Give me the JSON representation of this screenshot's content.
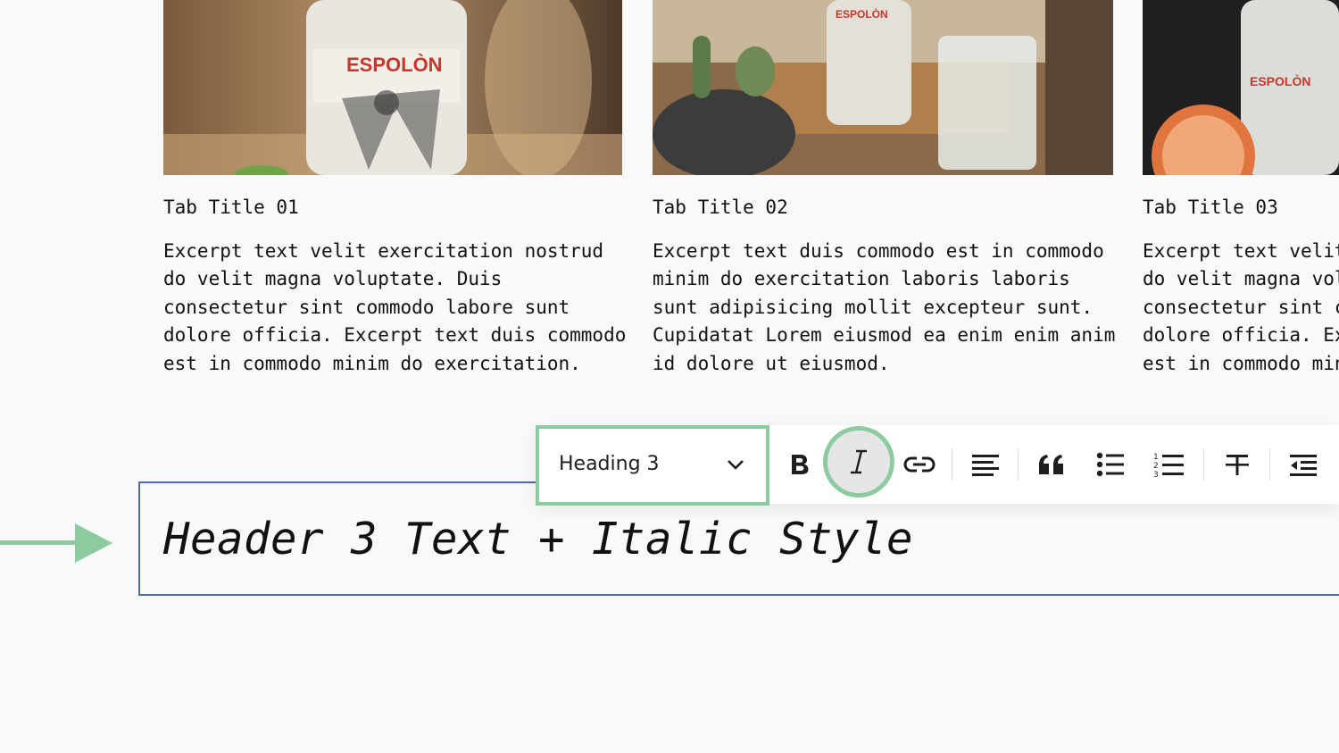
{
  "cards": [
    {
      "title": "Tab Title 01",
      "excerpt": "Excerpt text velit exercitation nostrud do velit magna voluptate. Duis consectetur sint commodo labore sunt dolore officia. Excerpt text duis commodo est in commodo minim do exercitation.",
      "image_alt": "Espolòn tequila bottle"
    },
    {
      "title": "Tab Title 02",
      "excerpt": "Excerpt text duis commodo est in commodo minim do exercitation laboris laboris sunt adipisicing mollit excepteur sunt. Cupidatat Lorem eiusmod ea enim enim anim id dolore ut eiusmod.",
      "image_alt": "Tequila bottle with cocktail and cactus"
    },
    {
      "title": "Tab Title 03",
      "excerpt": "Excerpt text velit exercitation nostrud do velit magna voluptate. Duis consectetur sint commodo labore sunt dolore officia. Excerpt text duis commodo est in commodo minim do exercitation.",
      "image_alt": "Tequila bottle with grapefruit"
    }
  ],
  "toolbar": {
    "block_type": "Heading 3",
    "buttons": [
      "bold-icon",
      "italic-icon",
      "link-icon",
      "align-left-icon",
      "quote-icon",
      "bullet-list-icon",
      "numbered-list-icon",
      "strikethrough-icon",
      "outdent-icon"
    ],
    "active_button": "italic-icon"
  },
  "editor": {
    "heading_text": "Header 3 Text + Italic Style"
  },
  "colors": {
    "highlight": "#8ccba0",
    "block_border": "#4a6bb8",
    "background": "#f9f9fa"
  }
}
